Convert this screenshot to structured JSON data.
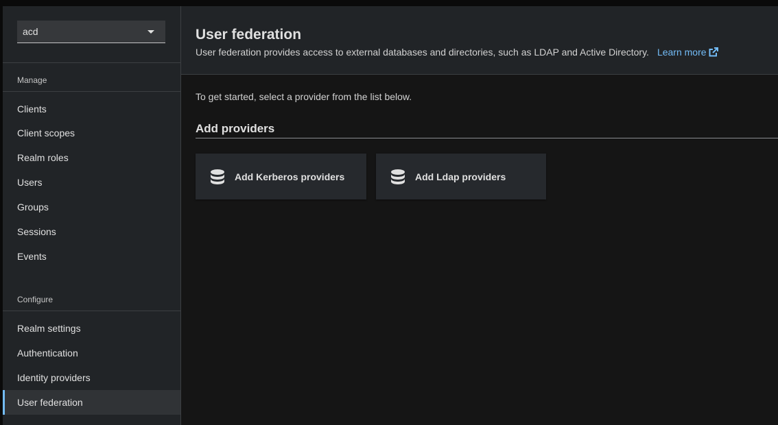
{
  "realm": {
    "selected": "acd"
  },
  "sidebar": {
    "manage_title": "Manage",
    "manage_items": [
      {
        "label": "Clients"
      },
      {
        "label": "Client scopes"
      },
      {
        "label": "Realm roles"
      },
      {
        "label": "Users"
      },
      {
        "label": "Groups"
      },
      {
        "label": "Sessions"
      },
      {
        "label": "Events"
      }
    ],
    "configure_title": "Configure",
    "configure_items": [
      {
        "label": "Realm settings"
      },
      {
        "label": "Authentication"
      },
      {
        "label": "Identity providers"
      },
      {
        "label": "User federation",
        "active": true
      }
    ]
  },
  "header": {
    "title": "User federation",
    "description": "User federation provides access to external databases and directories, such as LDAP and Active Directory.",
    "learn_more": "Learn more"
  },
  "main": {
    "intro": "To get started, select a provider from the list below.",
    "add_providers_title": "Add providers",
    "cards": [
      {
        "label": "Add Kerberos providers",
        "icon": "database-icon"
      },
      {
        "label": "Add Ldap providers",
        "icon": "database-icon"
      }
    ]
  },
  "colors": {
    "accent": "#73bcf7",
    "background": "#151515",
    "sidebar": "#212427"
  }
}
